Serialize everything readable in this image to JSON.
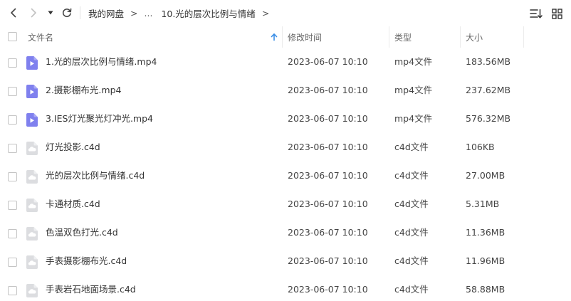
{
  "navigation": {
    "back_icon": "chevron-left-icon",
    "forward_icon": "chevron-right-icon",
    "history_icon": "caret-down-icon",
    "refresh_icon": "refresh-icon",
    "breadcrumb": {
      "root": "我的网盘",
      "separator": ">",
      "ellipsis": "...",
      "current": "10.光的层次比例与情绪",
      "trailing_separator": ">"
    },
    "sort_menu_icon": "sort-list-icon",
    "view_mode_icon": "grid-view-icon"
  },
  "table": {
    "columns": {
      "name": "文件名",
      "modified": "修改时间",
      "type": "类型",
      "size": "大小"
    },
    "sort_icon": "sort-ascending-arrow-icon",
    "accent_color": "#3a8ee6",
    "rows": [
      {
        "name": "1.光的层次比例与情绪.mp4",
        "modified": "2023-06-07 10:10",
        "type": "mp4文件",
        "size": "183.56MB",
        "icon": "video-file-icon"
      },
      {
        "name": "2.摄影棚布光.mp4",
        "modified": "2023-06-07 10:10",
        "type": "mp4文件",
        "size": "237.62MB",
        "icon": "video-file-icon"
      },
      {
        "name": "3.IES灯光聚光灯冲光.mp4",
        "modified": "2023-06-07 10:10",
        "type": "mp4文件",
        "size": "576.32MB",
        "icon": "video-file-icon"
      },
      {
        "name": "灯光投影.c4d",
        "modified": "2023-06-07 10:10",
        "type": "c4d文件",
        "size": "106KB",
        "icon": "generic-file-icon"
      },
      {
        "name": "光的层次比例与情绪.c4d",
        "modified": "2023-06-07 10:10",
        "type": "c4d文件",
        "size": "27.00MB",
        "icon": "generic-file-icon"
      },
      {
        "name": "卡通材质.c4d",
        "modified": "2023-06-07 10:10",
        "type": "c4d文件",
        "size": "5.31MB",
        "icon": "generic-file-icon"
      },
      {
        "name": "色温双色打光.c4d",
        "modified": "2023-06-07 10:10",
        "type": "c4d文件",
        "size": "11.36MB",
        "icon": "generic-file-icon"
      },
      {
        "name": "手表摄影棚布光.c4d",
        "modified": "2023-06-07 10:10",
        "type": "c4d文件",
        "size": "11.96MB",
        "icon": "generic-file-icon"
      },
      {
        "name": "手表岩石地面场景.c4d",
        "modified": "2023-06-07 10:10",
        "type": "c4d文件",
        "size": "58.88MB",
        "icon": "generic-file-icon"
      }
    ]
  },
  "colors": {
    "video_icon": "#7f80ee",
    "file_icon": "#d9dadc"
  }
}
